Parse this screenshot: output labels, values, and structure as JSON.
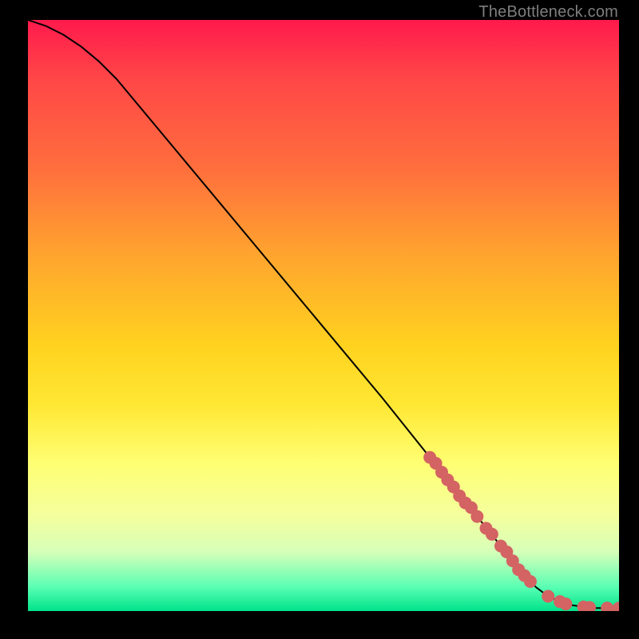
{
  "attribution": "TheBottleneck.com",
  "colors": {
    "marker": "#d46363",
    "line": "#000000",
    "background_frame": "#000000"
  },
  "chart_data": {
    "type": "line",
    "title": "",
    "xlabel": "",
    "ylabel": "",
    "xlim": [
      0,
      100
    ],
    "ylim": [
      0,
      100
    ],
    "grid": false,
    "legend": false,
    "axis_ticks_visible": false,
    "series": [
      {
        "name": "curve",
        "x": [
          0,
          3,
          6,
          9,
          12,
          15,
          20,
          30,
          40,
          50,
          60,
          68,
          72,
          76,
          80,
          83,
          86,
          88,
          90,
          92,
          94,
          96,
          98,
          100
        ],
        "y": [
          100,
          99,
          97.5,
          95.5,
          93,
          90,
          84,
          72,
          60,
          48,
          36,
          26,
          21,
          16,
          11,
          7,
          4,
          2.5,
          1.6,
          1.0,
          0.7,
          0.5,
          0.5,
          0.5
        ]
      }
    ],
    "markers": [
      {
        "x": 68,
        "y": 26
      },
      {
        "x": 69,
        "y": 25
      },
      {
        "x": 70,
        "y": 23.5
      },
      {
        "x": 71,
        "y": 22.2
      },
      {
        "x": 72,
        "y": 21
      },
      {
        "x": 73,
        "y": 19.5
      },
      {
        "x": 74,
        "y": 18.3
      },
      {
        "x": 75,
        "y": 17.5
      },
      {
        "x": 76,
        "y": 16
      },
      {
        "x": 77.5,
        "y": 14
      },
      {
        "x": 78.5,
        "y": 13
      },
      {
        "x": 80,
        "y": 11
      },
      {
        "x": 81,
        "y": 10
      },
      {
        "x": 82,
        "y": 8.5
      },
      {
        "x": 83,
        "y": 7
      },
      {
        "x": 84,
        "y": 6
      },
      {
        "x": 85,
        "y": 5
      },
      {
        "x": 88,
        "y": 2.5
      },
      {
        "x": 90,
        "y": 1.6
      },
      {
        "x": 91,
        "y": 1.2
      },
      {
        "x": 94,
        "y": 0.7
      },
      {
        "x": 95,
        "y": 0.6
      },
      {
        "x": 98,
        "y": 0.5
      },
      {
        "x": 100,
        "y": 0.5
      }
    ]
  }
}
